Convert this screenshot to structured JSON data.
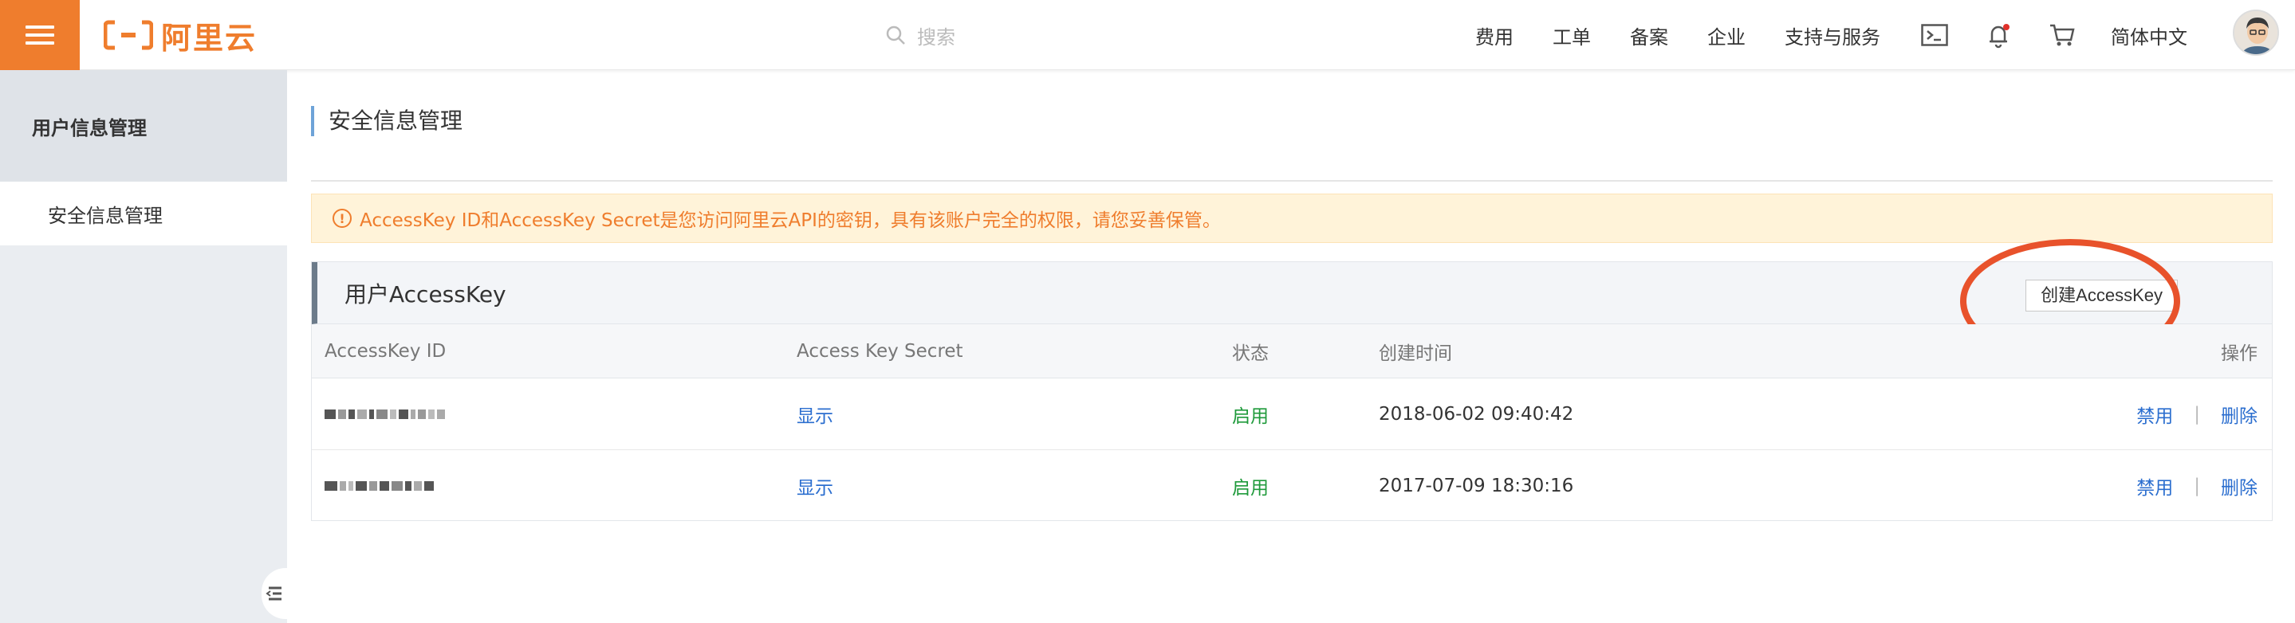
{
  "header": {
    "logo_text": "阿里云",
    "search_placeholder": "搜索",
    "nav": [
      "费用",
      "工单",
      "备案",
      "企业",
      "支持与服务"
    ],
    "language": "简体中文",
    "accent_color": "#ef7d2d"
  },
  "sidebar": {
    "title": "用户信息管理",
    "items": [
      {
        "label": "安全信息管理"
      }
    ]
  },
  "main": {
    "page_title": "安全信息管理",
    "alert": "AccessKey ID和AccessKey Secret是您访问阿里云API的密钥，具有该账户完全的权限，请您妥善保管。",
    "card_title": "用户AccessKey",
    "create_button": "创建AccessKey",
    "columns": [
      "AccessKey ID",
      "Access Key Secret",
      "状态",
      "创建时间",
      "操作"
    ],
    "rows": [
      {
        "secret_action": "显示",
        "status": "启用",
        "created": "2018-06-02 09:40:42",
        "disable": "禁用",
        "sep": "|",
        "delete": "删除"
      },
      {
        "secret_action": "显示",
        "status": "启用",
        "created": "2017-07-09 18:30:16",
        "disable": "禁用",
        "sep": "|",
        "delete": "删除"
      }
    ]
  }
}
